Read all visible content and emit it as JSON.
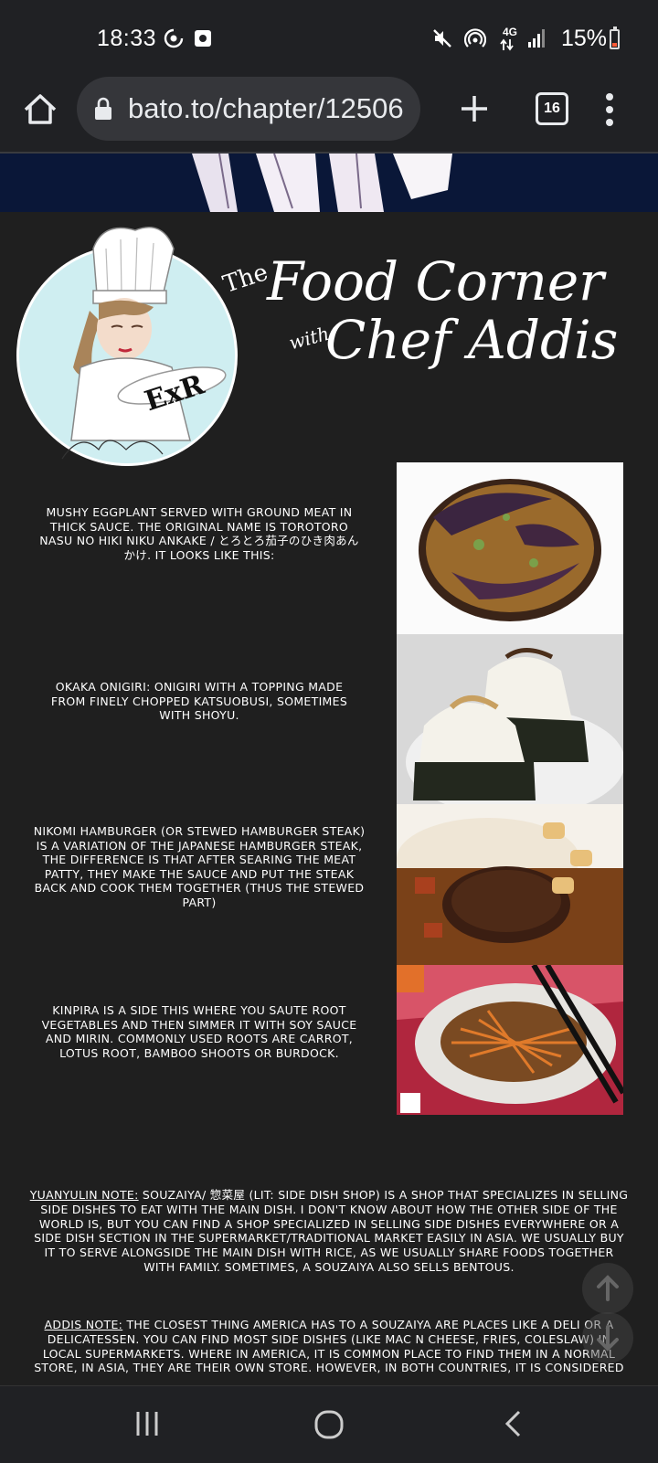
{
  "status_bar": {
    "time": "18:33",
    "battery_percent": "15%",
    "network_label": "4G",
    "icons": [
      "cast-icon",
      "screenshot-icon",
      "mute-icon",
      "hotspot-icon",
      "data-arrows-icon",
      "signal-icon",
      "battery-icon"
    ]
  },
  "browser": {
    "url": "bato.to/chapter/12506",
    "tab_count": "16",
    "icons": [
      "home-icon",
      "lock-icon",
      "plus-icon",
      "tabs-icon",
      "more-vert-icon"
    ]
  },
  "header": {
    "line1_small": "The",
    "line1_main": "Food Corner",
    "line2_small": "with",
    "line2_main": "Chef Addis",
    "logo_text": "ExR"
  },
  "foods": [
    {
      "text": "MUSHY EGGPLANT SERVED WITH GROUND MEAT IN THICK SAUCE. THE ORIGINAL NAME IS TOROTORO NASU NO HIKI NIKU ANKAKE / とろとろ茄子のひき肉あんかけ. IT LOOKS LIKE THIS:",
      "image": "eggplant-dish"
    },
    {
      "text": "OKAKA ONIGIRI: ONIGIRI WITH A TOPPING MADE FROM FINELY CHOPPED KATSUOBUSI, SOMETIMES WITH SHOYU.",
      "image": "onigiri"
    },
    {
      "text": "NIKOMI HAMBURGER (OR STEWED HAMBURGER STEAK) IS A VARIATION OF THE JAPANESE HAMBURGER STEAK, THE DIFFERENCE IS THAT AFTER SEARING THE MEAT PATTY, THEY MAKE THE SAUCE AND PUT THE STEAK BACK AND COOK THEM TOGETHER (THUS THE STEWED PART)",
      "image": "hamburger-steak"
    },
    {
      "text": "KINPIRA IS A SIDE THIS WHERE YOU SAUTE ROOT VEGETABLES AND THEN SIMMER IT WITH SOY SAUCE AND MIRIN. COMMONLY USED ROOTS ARE CARROT, LOTUS ROOT, BAMBOO SHOOTS OR BURDOCK.",
      "image": "kinpira"
    }
  ],
  "notes": {
    "yuanyulin_label": "YUANYULIN NOTE:",
    "yuanyulin_text": " SOUZAIYA/ 惣菜屋 (LIT: SIDE DISH SHOP) IS A SHOP THAT SPECIALIZES IN SELLING SIDE DISHES TO EAT WITH THE MAIN DISH. I DON'T KNOW ABOUT HOW THE OTHER SIDE OF THE WORLD IS, BUT YOU CAN FIND A SHOP SPECIALIZED IN SELLING SIDE DISHES EVERYWHERE OR A SIDE DISH SECTION IN THE SUPERMARKET/TRADITIONAL MARKET EASILY IN ASIA. WE USUALLY BUY IT TO SERVE ALONGSIDE THE MAIN DISH WITH RICE, AS WE USUALLY SHARE FOODS TOGETHER WITH FAMILY. SOMETIMES, A SOUZAIYA ALSO SELLS BENTOUS.",
    "addis_label": "ADDIS NOTE:",
    "addis_text": " THE CLOSEST THING AMERICA HAS TO A SOUZAIYA ARE PLACES LIKE A DELI OR A DELICATESSEN. YOU CAN FIND MOST SIDE DISHES (LIKE MAC N CHEESE, FRIES, COLESLAW) IN LOCAL SUPERMARKETS. WHERE IN AMERICA, IT IS COMMON PLACE TO FIND THEM IN A NORMAL STORE, IN ASIA, THEY ARE THEIR OWN STORE. HOWEVER, IN BOTH COUNTRIES, IT IS CONSIDERED"
  },
  "scroll": {
    "up_icon": "arrow-up-icon",
    "down_icon": "arrow-down-icon"
  },
  "nav": {
    "icons": [
      "recents-icon",
      "home-circle-icon",
      "back-icon"
    ]
  }
}
